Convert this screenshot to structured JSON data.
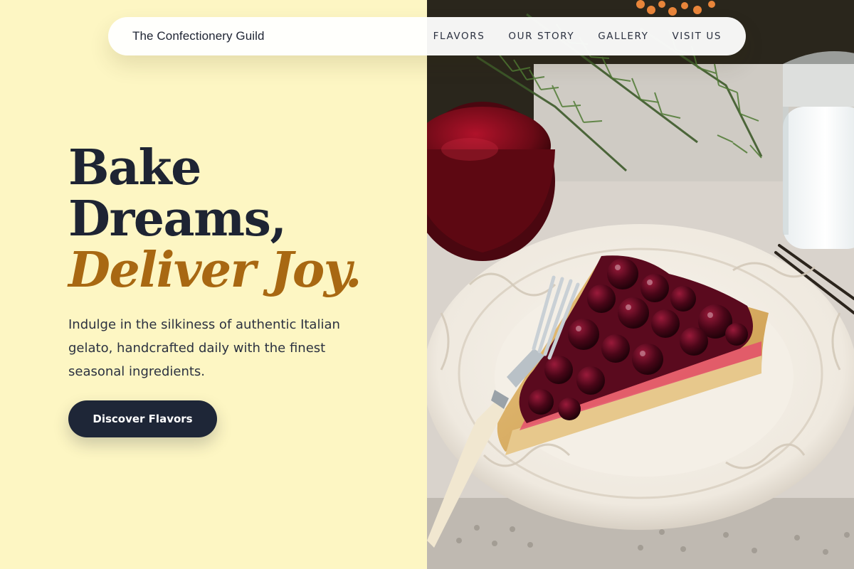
{
  "brand": {
    "name": "The Confectionery Guild"
  },
  "nav": {
    "links": [
      {
        "label": "FLAVORS"
      },
      {
        "label": "OUR STORY"
      },
      {
        "label": "GALLERY"
      },
      {
        "label": "VISIT US"
      }
    ]
  },
  "hero": {
    "headline_line1": "Bake",
    "headline_line2": "Dreams,",
    "headline_accent": "Deliver Joy.",
    "subtitle": "Indulge in the silkiness of authentic Italian gelato, handcrafted daily with the finest seasonal ingredients.",
    "cta_label": "Discover Flavors"
  },
  "colors": {
    "background": "#fdf6c3",
    "heading": "#1e2433",
    "accent": "#a86812",
    "button": "#1e2637"
  }
}
